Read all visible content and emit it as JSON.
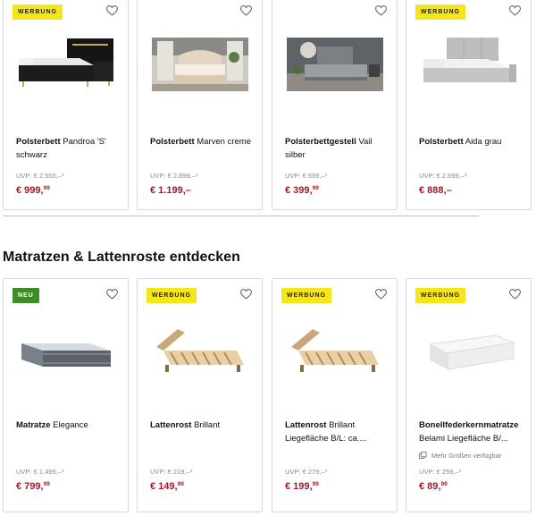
{
  "colors": {
    "ad_badge": "#f5e51a",
    "new_badge": "#3c8e24",
    "price": "#a5192a",
    "uvp": "#8a8a8a",
    "card_border": "#d8d8d8"
  },
  "top_row": [
    {
      "badge": "WERBUNG",
      "badge_type": "ad",
      "title_bold": "Polsterbett",
      "title_rest": " Pandroa 'S' schwarz",
      "uvp": "UVP: € 2.550,–*",
      "price_main": "€ 999,",
      "price_sup": "99",
      "image": "black-boxspring-bed"
    },
    {
      "badge": "",
      "badge_type": "",
      "title_bold": "Polsterbett",
      "title_rest": " Marven creme",
      "uvp": "UVP: € 2.899,–*",
      "price_main": "€ 1.199,–",
      "price_sup": "",
      "image": "cream-bed-room"
    },
    {
      "badge": "",
      "badge_type": "",
      "title_bold": "Polsterbettgestell",
      "title_rest": " Vail silber",
      "uvp": "UVP: € 699,–*",
      "price_main": "€ 399,",
      "price_sup": "99",
      "image": "grey-bed-room"
    },
    {
      "badge": "WERBUNG",
      "badge_type": "ad",
      "title_bold": "Polsterbett",
      "title_rest": " Aida grau",
      "uvp": "UVP: € 2.699,–*",
      "price_main": "€ 888,–",
      "price_sup": "",
      "image": "grey-boxspring-bed"
    }
  ],
  "section_title": "Matratzen & Lattenroste entdecken",
  "bottom_row": [
    {
      "badge": "NEU",
      "badge_type": "new",
      "title_bold": "Matratze",
      "title_rest": " Elegance",
      "uvp": "UVP: € 1.499,–*",
      "price_main": "€ 799,",
      "price_sup": "99",
      "more_sizes": "",
      "image": "mattress"
    },
    {
      "badge": "WERBUNG",
      "badge_type": "ad",
      "title_bold": "Lattenrost",
      "title_rest": " Brillant",
      "uvp": "UVP: € 219,–*",
      "price_main": "€ 149,",
      "price_sup": "99",
      "more_sizes": "",
      "image": "slatted-frame"
    },
    {
      "badge": "WERBUNG",
      "badge_type": "ad",
      "title_bold": "Lattenrost",
      "title_rest": " Brillant Liegefläche B/L: ca....",
      "uvp": "UVP: € 279,–*",
      "price_main": "€ 199,",
      "price_sup": "99",
      "more_sizes": "",
      "image": "slatted-frame"
    },
    {
      "badge": "WERBUNG",
      "badge_type": "ad",
      "title_bold": "Bonellfederkernmatratze",
      "title_rest": " Belami Liegefläche B/...",
      "uvp": "UVP: € 259,–*",
      "price_main": "€ 89,",
      "price_sup": "99",
      "more_sizes": "Mehr Größen verfügbar",
      "image": "white-mattress"
    }
  ]
}
